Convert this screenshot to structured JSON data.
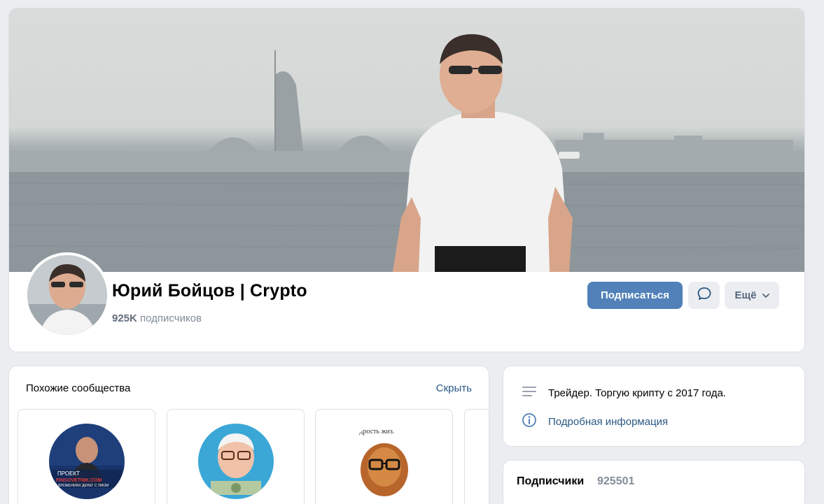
{
  "profile": {
    "name": "Юрий Бойцов | Crypto",
    "subscribers_count": "925K",
    "subscribers_label": "подписчиков"
  },
  "actions": {
    "subscribe_label": "Подписаться",
    "message_icon": "message-bubble-icon",
    "more_label": "Ещё",
    "more_icon": "chevron-down-icon"
  },
  "similar": {
    "title": "Похожие сообщества",
    "hide_label": "Скрыть",
    "tiles": [
      {
        "avatar_caption_1": "ПРОЕКТ",
        "avatar_caption_2": "FINSOVETNIK.COM",
        "avatar_caption_3": "О ВЛОЖЕНИЯХ ДЕНЕГ С УМОМ"
      },
      {
        "avatar_caption_1": ""
      },
      {
        "avatar_caption_1": "удрость жиз."
      }
    ]
  },
  "about": {
    "description": "Трейдер. Торгую крипту с 2017 года.",
    "description_icon": "lines-icon",
    "details_label": "Подробная информация",
    "details_icon": "info-icon"
  },
  "followers": {
    "label": "Подписчики",
    "count": "925501"
  },
  "colors": {
    "accent": "#5181b8",
    "link": "#2a5885",
    "muted": "#818c99",
    "background": "#ebedf0"
  }
}
